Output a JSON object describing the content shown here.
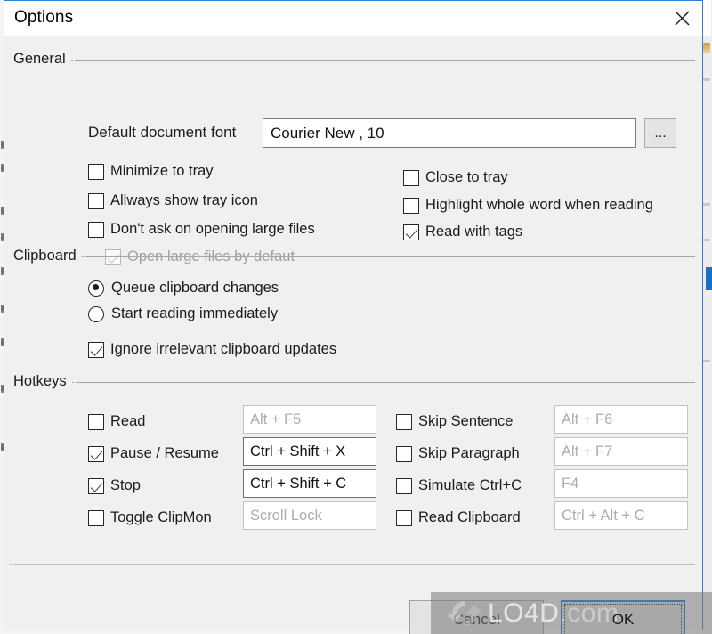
{
  "window": {
    "title": "Options",
    "close_icon": "close-icon"
  },
  "groups": {
    "general": "General",
    "clipboard": "Clipboard",
    "hotkeys": "Hotkeys"
  },
  "general": {
    "font_label": "Default document font",
    "font_value": "Courier New , 10",
    "browse_label": "...",
    "left_checkboxes": [
      {
        "label": "Minimize to tray",
        "checked": false,
        "disabled": false
      },
      {
        "label": "Allways show tray icon",
        "checked": false,
        "disabled": false
      },
      {
        "label": "Don't ask on opening large files",
        "checked": false,
        "disabled": false
      },
      {
        "label": "Open large files by defaut",
        "checked": true,
        "disabled": true
      }
    ],
    "right_checkboxes": [
      {
        "label": "Close to tray",
        "checked": false,
        "disabled": false
      },
      {
        "label": "Highlight whole word when reading",
        "checked": false,
        "disabled": false
      },
      {
        "label": "Read with tags",
        "checked": true,
        "disabled": false
      }
    ]
  },
  "clipboard": {
    "radios": [
      {
        "label": "Queue clipboard changes",
        "selected": true
      },
      {
        "label": "Start reading immediately",
        "selected": false
      }
    ],
    "checkbox": {
      "label": "Ignore irrelevant clipboard updates",
      "checked": true
    }
  },
  "hotkeys": {
    "left": [
      {
        "label": "Read",
        "checked": false,
        "value": "Alt + F5",
        "enabled": false
      },
      {
        "label": "Pause / Resume",
        "checked": true,
        "value": "Ctrl + Shift + X",
        "enabled": true
      },
      {
        "label": "Stop",
        "checked": true,
        "value": "Ctrl + Shift + C",
        "enabled": true
      },
      {
        "label": "Toggle ClipMon",
        "checked": false,
        "value": "Scroll Lock",
        "enabled": false
      }
    ],
    "right": [
      {
        "label": "Skip Sentence",
        "checked": false,
        "value": "Alt + F6",
        "enabled": false
      },
      {
        "label": "Skip Paragraph",
        "checked": false,
        "value": "Alt + F7",
        "enabled": false
      },
      {
        "label": "Simulate Ctrl+C",
        "checked": false,
        "value": "F4",
        "enabled": false
      },
      {
        "label": "Read Clipboard",
        "checked": false,
        "value": "Ctrl + Alt + C",
        "enabled": false
      }
    ]
  },
  "footer": {
    "cancel_label": "Cancel",
    "ok_label": "OK"
  },
  "watermark": {
    "text": "LO4D",
    "suffix": ".com"
  },
  "colors": {
    "window_border": "#2b7fd4",
    "dialog_bg": "#f0f0f0",
    "titlebar_bg": "#ffffff",
    "focus_blue": "#1571c8",
    "text": "#1b1b1b",
    "disabled_text": "#adadad"
  }
}
